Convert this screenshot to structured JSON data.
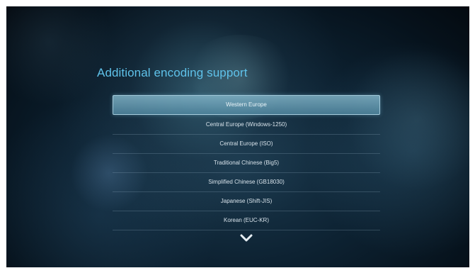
{
  "screen": {
    "title": "Additional encoding support",
    "options": [
      {
        "label": "Western Europe",
        "selected": true
      },
      {
        "label": "Central Europe (Windows-1250)",
        "selected": false
      },
      {
        "label": "Central Europe (ISO)",
        "selected": false
      },
      {
        "label": "Traditional Chinese (Big5)",
        "selected": false
      },
      {
        "label": "Simplified Chinese (GB18030)",
        "selected": false
      },
      {
        "label": "Japanese (Shift-JIS)",
        "selected": false
      },
      {
        "label": "Korean (EUC-KR)",
        "selected": false
      }
    ],
    "scroll_icon": "chevron-down-icon"
  },
  "colors": {
    "title": "#5fc2ea",
    "selection": "#6fa9c0"
  }
}
